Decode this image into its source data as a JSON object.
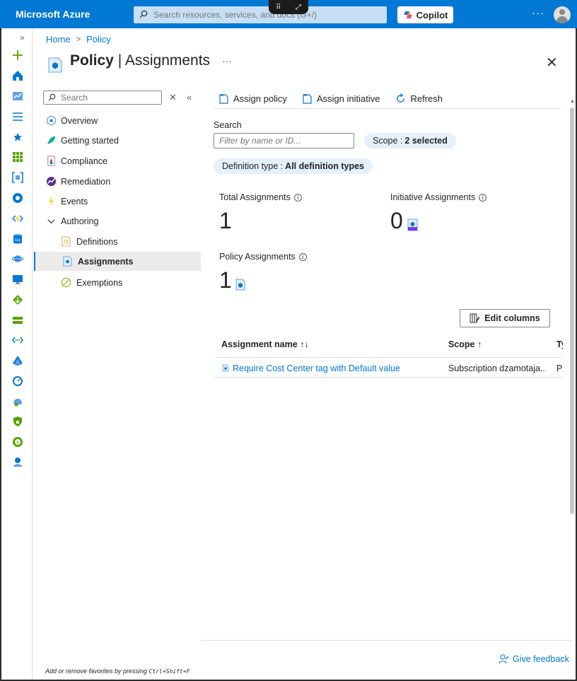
{
  "topbar": {
    "brand": "Microsoft Azure",
    "search_placeholder": "Search resources, services, and docs (G+/)",
    "copilot_label": "Copilot",
    "more_label": "···"
  },
  "breadcrumb": {
    "home": "Home",
    "policy": "Policy"
  },
  "header": {
    "title_bold": "Policy",
    "title_sep": " | ",
    "title_rest": "Assignments",
    "more": "···"
  },
  "nav": {
    "search_placeholder": "Search",
    "items": [
      {
        "label": "Overview",
        "icon": "overview-icon"
      },
      {
        "label": "Getting started",
        "icon": "rocket-icon"
      },
      {
        "label": "Compliance",
        "icon": "compliance-icon"
      },
      {
        "label": "Remediation",
        "icon": "remediation-icon"
      },
      {
        "label": "Events",
        "icon": "lightning-icon"
      },
      {
        "label": "Authoring",
        "icon": "chevron-down-icon"
      },
      {
        "label": "Definitions",
        "icon": "definitions-icon"
      },
      {
        "label": "Assignments",
        "icon": "assignments-icon"
      },
      {
        "label": "Exemptions",
        "icon": "exemptions-icon"
      }
    ],
    "favorites_note": "Add or remove favorites by pressing",
    "favorites_shortcut": "Ctrl+Shift+F"
  },
  "toolbar": {
    "assign_policy": "Assign policy",
    "assign_initiative": "Assign initiative",
    "refresh": "Refresh"
  },
  "filters": {
    "search_label": "Search",
    "search_placeholder": "Filter by name or ID...",
    "scope_prefix": "Scope :",
    "scope_value": "2 selected",
    "deftype_prefix": "Definition type :",
    "deftype_value": "All definition types"
  },
  "stats": {
    "total_label": "Total Assignments",
    "total_value": "1",
    "initiative_label": "Initiative Assignments",
    "initiative_value": "0",
    "policy_label": "Policy Assignments",
    "policy_value": "1"
  },
  "edit_columns": "Edit columns",
  "table": {
    "columns": [
      "Assignment name ↑↓",
      "Scope ↑",
      "Ty"
    ],
    "rows": [
      {
        "name": "Require Cost Center tag with Default value",
        "scope": "Subscription dzamotaja...",
        "type": "Po"
      }
    ]
  },
  "feedback": "Give feedback",
  "colors": {
    "accent": "#0078d4",
    "topbar": "#0078d4",
    "pill": "#e5f0fb"
  }
}
